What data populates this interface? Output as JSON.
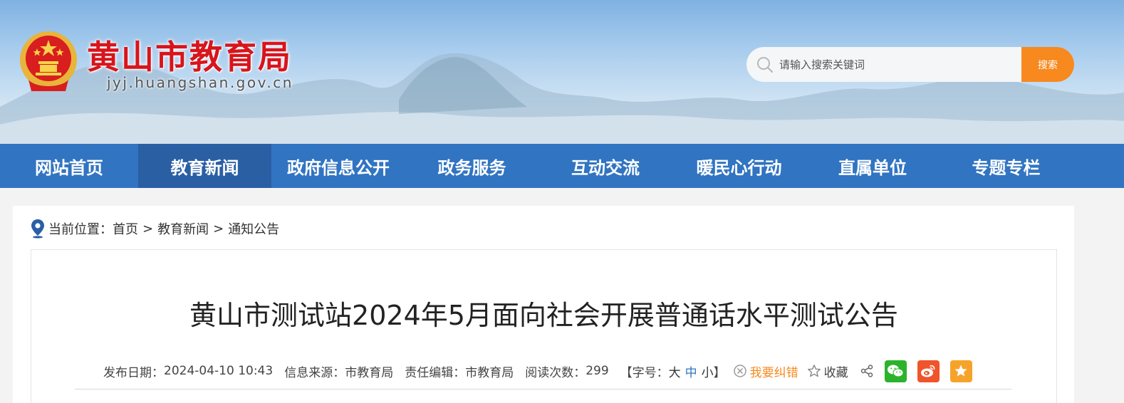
{
  "header": {
    "title": "黄山市教育局",
    "url": "jyj.huangshan.gov.cn",
    "search_placeholder": "请输入搜索关键词",
    "search_button": "搜索"
  },
  "nav": {
    "items": [
      {
        "label": "网站首页"
      },
      {
        "label": "教育新闻"
      },
      {
        "label": "政府信息公开"
      },
      {
        "label": "政务服务"
      },
      {
        "label": "互动交流"
      },
      {
        "label": "暖民心行动"
      },
      {
        "label": "直属单位"
      },
      {
        "label": "专题专栏"
      }
    ]
  },
  "breadcrumb": {
    "prefix": "当前位置：",
    "home": "首页",
    "sep": ">",
    "level1": "教育新闻",
    "level2": "通知公告"
  },
  "article": {
    "title": "黄山市测试站2024年5月面向社会开展普通话水平测试公告",
    "publish_label": "发布日期：",
    "publish_date": "2024-04-10 10:43",
    "source_label": "信息来源：",
    "source": "市教育局",
    "editor_label": "责任编辑：",
    "editor": "市教育局",
    "views_label": "阅读次数：",
    "views": "299",
    "font_open": "【字号：",
    "font_large": "大",
    "font_medium": "中",
    "font_small": "小",
    "font_close": "】",
    "report_error": "我要纠错",
    "favorite": "收藏"
  },
  "colors": {
    "nav_bg": "#3174c2",
    "nav_active": "#2a5fa4",
    "title_red": "#d8141c",
    "accent_orange": "#f7891f",
    "wechat": "#2bb32b",
    "weibo": "#f0542a",
    "star": "#f7a32a"
  },
  "icons": [
    "national-emblem-icon",
    "search-icon",
    "location-pin-icon",
    "report-error-icon",
    "star-outline-icon",
    "share-icon",
    "wechat-icon",
    "weibo-icon",
    "favorite-star-icon"
  ]
}
